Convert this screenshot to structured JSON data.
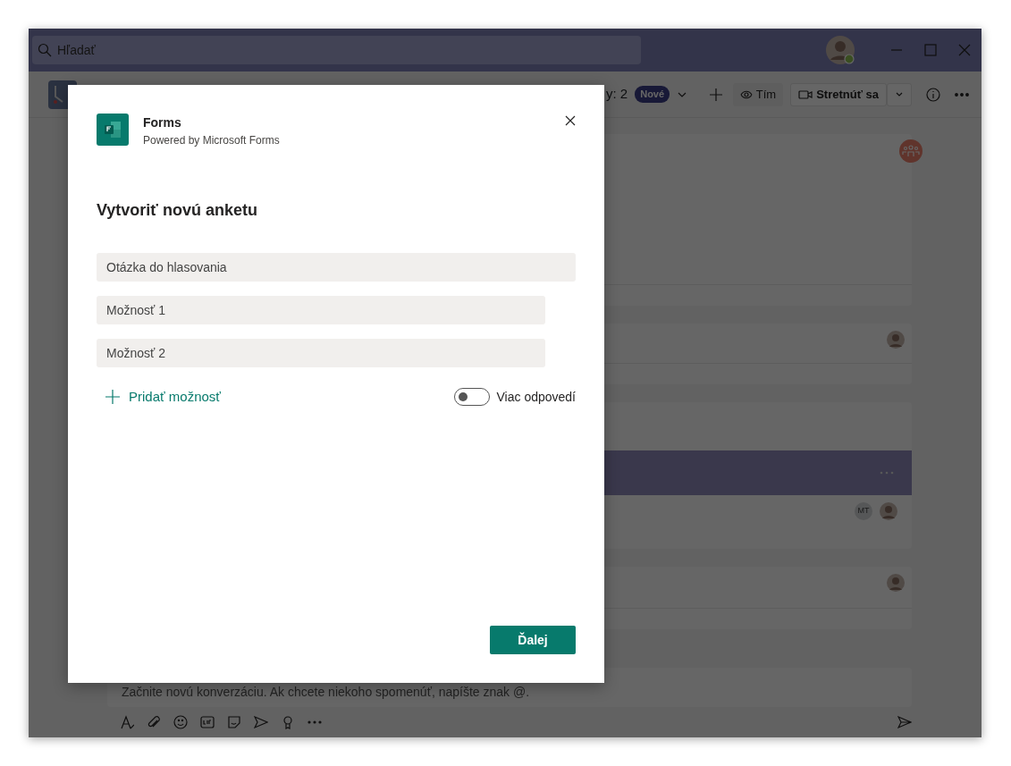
{
  "title_bar": {
    "search": {
      "placeholder": "Hľadať"
    }
  },
  "channel_header": {
    "tab_fragment": "y: 2",
    "new_badge": "Nové",
    "team_button": "Tím",
    "meet_button": "Stretnúť sa"
  },
  "feed": {
    "avatar_initials": "MT"
  },
  "composer": {
    "placeholder": "Začnite novú konverzáciu. Ak chcete niekoho spomenúť, napíšte znak @."
  },
  "dialog": {
    "app_name": "Forms",
    "app_subtitle": "Powered by Microsoft Forms",
    "heading": "Vytvoriť novú anketu",
    "question": {
      "placeholder": "Otázka do hlasovania"
    },
    "options": [
      {
        "placeholder": "Možnosť 1"
      },
      {
        "placeholder": "Možnosť 2"
      }
    ],
    "add_option": "Pridať možnosť",
    "multiple_answers": {
      "label": "Viac odpovedí",
      "on": false
    },
    "next_button": "Ďalej"
  }
}
